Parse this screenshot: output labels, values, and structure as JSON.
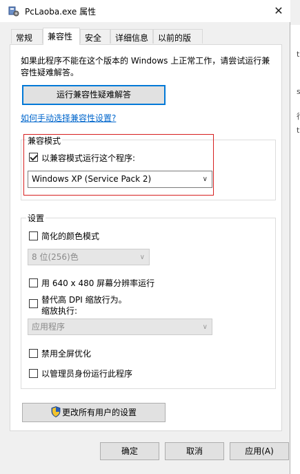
{
  "window": {
    "title": "PcLaoba.exe 属性",
    "close_glyph": "✕"
  },
  "tabs": [
    {
      "label": "常规"
    },
    {
      "label": "兼容性"
    },
    {
      "label": "安全"
    },
    {
      "label": "详细信息"
    },
    {
      "label": "以前的版本"
    }
  ],
  "intro": "如果此程序不能在这个版本的 Windows 上正常工作，请尝试运行兼容性疑难解答。",
  "troubleshoot_button": "运行兼容性疑难解答",
  "manual_link": "如何手动选择兼容性设置?",
  "compat_mode": {
    "group_title": "兼容模式",
    "checkbox_label": "以兼容模式运行这个程序:",
    "checked": true,
    "selected_os": "Windows XP (Service Pack 2)"
  },
  "settings": {
    "group_title": "设置",
    "reduced_color_label": "简化的颜色模式",
    "color_select": "8 位(256)色",
    "resolution_label": "用 640 x 480 屏幕分辨率运行",
    "dpi_label_line1": "替代高 DPI 缩放行为。",
    "dpi_label_line2": "缩放执行:",
    "dpi_select": "应用程序",
    "fullscreen_label": "禁用全屏优化",
    "admin_label": "以管理员身份运行此程序"
  },
  "change_all_users_button": "更改所有用户的设置",
  "footer": {
    "ok": "确定",
    "cancel": "取消",
    "apply": "应用(A)"
  },
  "background_glyphs": [
    "t",
    "s",
    "行",
    "t"
  ],
  "colors": {
    "accent": "#0078d7",
    "highlight_frame": "#d61e1e",
    "link": "#0066cc"
  }
}
